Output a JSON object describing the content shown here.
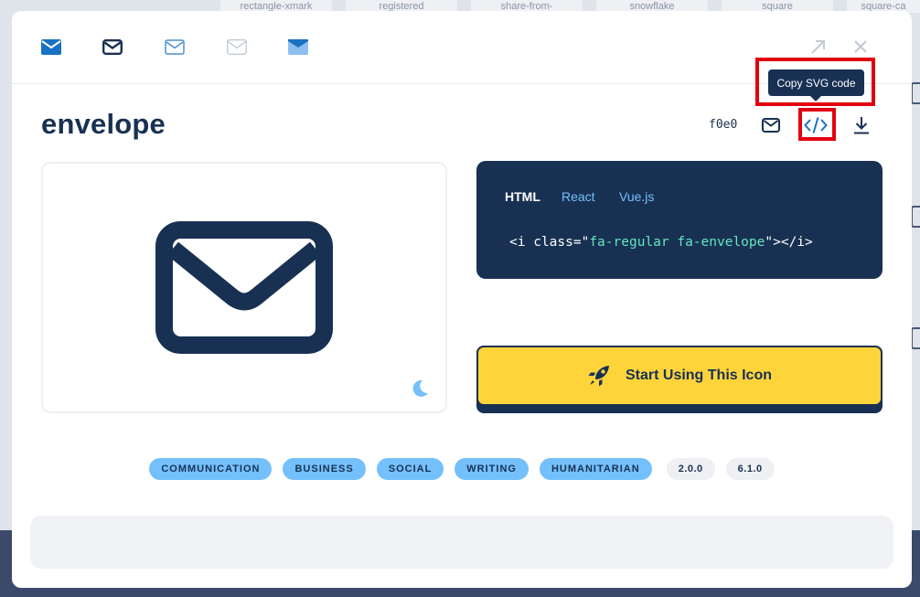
{
  "background": {
    "cards": [
      "rectangle-xmark",
      "registered",
      "share-from-",
      "snowflake",
      "square",
      "square-ca"
    ]
  },
  "styles": [
    "solid",
    "regular",
    "light",
    "thin",
    "duotone"
  ],
  "header": {
    "title": "envelope",
    "unicode": "f0e0"
  },
  "tooltip": "Copy SVG code",
  "code": {
    "tabs": [
      "HTML",
      "React",
      "Vue.js"
    ],
    "active_tab": "HTML",
    "line_prefix": "<i class=\"",
    "line_value": "fa-regular fa-envelope",
    "line_suffix": "\"></i>"
  },
  "cta": {
    "label": "Start Using This Icon"
  },
  "tags": {
    "categories": [
      "COMMUNICATION",
      "BUSINESS",
      "SOCIAL",
      "WRITING",
      "HUMANITARIAN"
    ],
    "versions": [
      "2.0.0",
      "6.1.0"
    ]
  },
  "colors": {
    "navy": "#183153",
    "accent_blue": "#74c0fc",
    "cta_yellow": "#ffd43b",
    "highlight_red": "#e10010"
  }
}
